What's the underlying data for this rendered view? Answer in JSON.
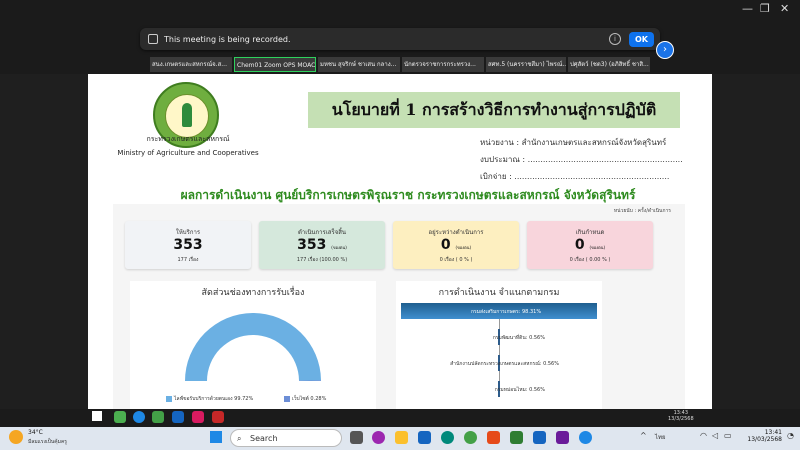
{
  "zoom": {
    "recording_text": "This meeting is being recorded.",
    "ok_label": "OK",
    "participants": [
      "สนง.เกษตรและสหกรณ์จ.ส...",
      "Chem01 Zoom OPS MOAC",
      "มหชน สุจริกษ์ ชาเสน กลาง...",
      "นักตรวจราชการกระทรวง...",
      "สศท.5 (นครราชสีมา) ไพรณ์...",
      "ปศุสัตว์ (ชด3) (อภิสิทธิ์ ชาสิ..."
    ],
    "clock": "13:43",
    "date": "13/3/2568"
  },
  "slide": {
    "org_th": "กระทรวงเกษตรและสหกรณ์",
    "org_en": "Ministry of Agriculture and Cooperatives",
    "policy_title": "นโยบายที่ 1 การสร้างวิธีการทำงานสู่การปฏิบัติ",
    "agency": "หน่วยงาน : สำนักงานเกษตรและสหกรณ์จังหวัดสุรินทร์",
    "budget": "งบประมาณ : .............................................................",
    "disbursed": "เบิกจ่าย : .............................................................",
    "result_title": "ผลการดำเนินงาน ศูนย์บริการเกษตรพิรุณราช กระทรวงเกษตรและสหกรณ์ จังหวัดสุรินทร์",
    "unit": "หน่วยนับ : ครั้ง/ดำเนินการ",
    "cards": [
      {
        "label": "ให้บริการ",
        "value": "353",
        "unit": "",
        "sub": "177 เรื่อง",
        "color": "#f1f3f6"
      },
      {
        "label": "ดำเนินการเสร็จสิ้น",
        "value": "353",
        "unit": "(ของตน)",
        "sub": "177 เรื่อง (100.00 %)",
        "color": "#d5e8dc"
      },
      {
        "label": "อยู่ระหว่างดำเนินการ",
        "value": "0",
        "unit": "(ของตน)",
        "sub": "0 เรื่อง ( 0 % )",
        "color": "#fdefc0"
      },
      {
        "label": "เกินกำหนด",
        "value": "0",
        "unit": "(ของตน)",
        "sub": "0 เรื่อง ( 0.00 % )",
        "color": "#f8d5dc"
      }
    ],
    "left_panel_title": "สัดส่วนช่องทางการรับเรื่อง",
    "right_panel_title": "การดำเนินงาน จำแนกตามกรม",
    "legend": [
      {
        "label": "ไลฟ์ขอรับบริการด้วยตนเอง 99.72%",
        "color": "#6bb0e3"
      },
      {
        "label": "เว็บไซต์ 0.28%",
        "color": "#6c8ed6"
      }
    ]
  },
  "chart_data": [
    {
      "type": "pie",
      "title": "สัดส่วนช่องทางการรับเรื่อง",
      "labels": [
        "ไลฟ์ขอรับบริการด้วยตนเอง",
        "เว็บไซต์"
      ],
      "values": [
        99.72,
        0.28
      ],
      "colors": [
        "#6bb0e3",
        "#6c8ed6"
      ]
    },
    {
      "type": "bar",
      "title": "การดำเนินงาน จำแนกตามกรม",
      "categories": [
        "กรมส่งเสริมการเกษตร",
        "กรมพัฒนาที่ดิน",
        "สำนักงานปลัดกระทรวงเกษตรและสหกรณ์",
        "กรมหม่อนไหม"
      ],
      "values": [
        98.31,
        0.56,
        0.56,
        0.56
      ]
    }
  ],
  "windows": {
    "temp": "34°C",
    "weather": "มีลมแรงเป็นคุ้มครู",
    "search_label": "Search",
    "lang": "ไทย",
    "clock": "13:41",
    "date": "13/03/2568"
  }
}
